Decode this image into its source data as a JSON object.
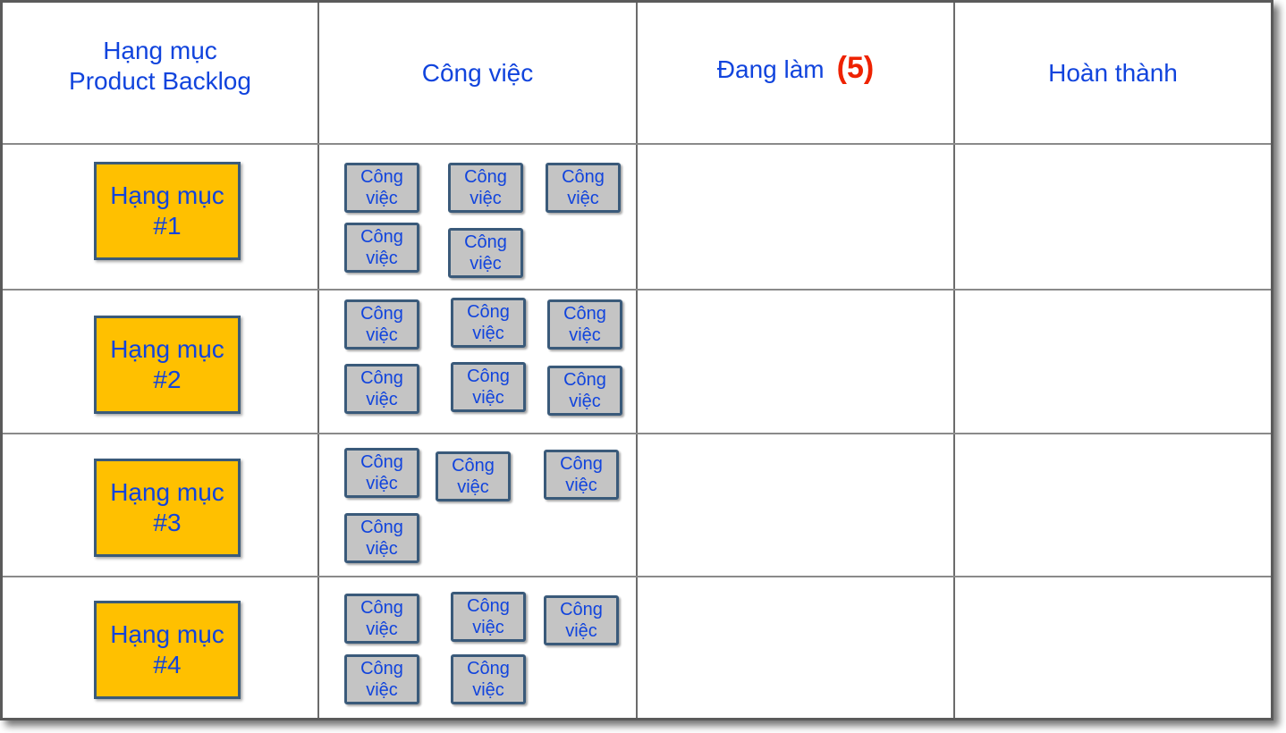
{
  "columns": {
    "backlog": {
      "line1": "Hạng mục",
      "line2": "Product Backlog"
    },
    "tasks": "Công việc",
    "in_progress": "Đang làm",
    "wip_limit": "(5)",
    "done": "Hoàn thành"
  },
  "rows": [
    {
      "item_line1": "Hạng mục",
      "item_line2": "#1",
      "tasks": [
        "Công\nviệc",
        "Công\nviệc",
        "Công\nviệc",
        "Công\nviệc",
        "Công\nviệc"
      ]
    },
    {
      "item_line1": "Hạng mục",
      "item_line2": "#2",
      "tasks": [
        "Công\nviệc",
        "Công\nviệc",
        "Công\nviệc",
        "Công\nviệc",
        "Công\nviệc",
        "Công\nviệc"
      ]
    },
    {
      "item_line1": "Hạng mục",
      "item_line2": "#3",
      "tasks": [
        "Công\nviệc",
        "Công\nviệc",
        "Công\nviệc",
        "Công\nviệc"
      ]
    },
    {
      "item_line1": "Hạng mục",
      "item_line2": "#4",
      "tasks": [
        "Công\nviệc",
        "Công\nviệc",
        "Công\nviệc",
        "Công\nviệc",
        "Công\nviệc"
      ]
    }
  ],
  "colors": {
    "item_card": "#ffc000",
    "task_card": "#c4c4c4",
    "text": "#1144dd",
    "wip_limit": "#ee2200"
  }
}
